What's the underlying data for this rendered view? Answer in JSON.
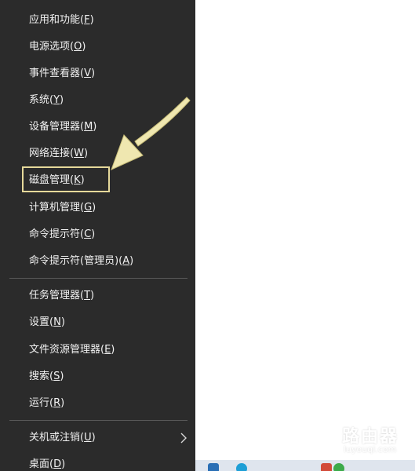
{
  "menu": {
    "items": [
      {
        "text": "应用和功能(",
        "key": "F",
        "end": ")"
      },
      {
        "text": "电源选项(",
        "key": "O",
        "end": ")"
      },
      {
        "text": "事件查看器(",
        "key": "V",
        "end": ")"
      },
      {
        "text": "系统(",
        "key": "Y",
        "end": ")"
      },
      {
        "text": "设备管理器(",
        "key": "M",
        "end": ")"
      },
      {
        "text": "网络连接(",
        "key": "W",
        "end": ")"
      },
      {
        "text": "磁盘管理(",
        "key": "K",
        "end": ")"
      },
      {
        "text": "计算机管理(",
        "key": "G",
        "end": ")"
      },
      {
        "text": "命令提示符(",
        "key": "C",
        "end": ")"
      },
      {
        "text": "命令提示符(管理员)(",
        "key": "A",
        "end": ")"
      },
      {
        "text": "任务管理器(",
        "key": "T",
        "end": ")"
      },
      {
        "text": "设置(",
        "key": "N",
        "end": ")"
      },
      {
        "text": "文件资源管理器(",
        "key": "E",
        "end": ")"
      },
      {
        "text": "搜索(",
        "key": "S",
        "end": ")"
      },
      {
        "text": "运行(",
        "key": "R",
        "end": ")"
      },
      {
        "text": "关机或注销(",
        "key": "U",
        "end": ")"
      },
      {
        "text": "桌面(",
        "key": "D",
        "end": ")"
      }
    ]
  },
  "watermark": {
    "title": "路由器",
    "url": "luyouqi.com"
  },
  "colors": {
    "menu_bg": "#2b2b2b",
    "menu_text": "#f2f2f2",
    "highlight": "#e6d99a",
    "arrow": "#efe7b0"
  }
}
